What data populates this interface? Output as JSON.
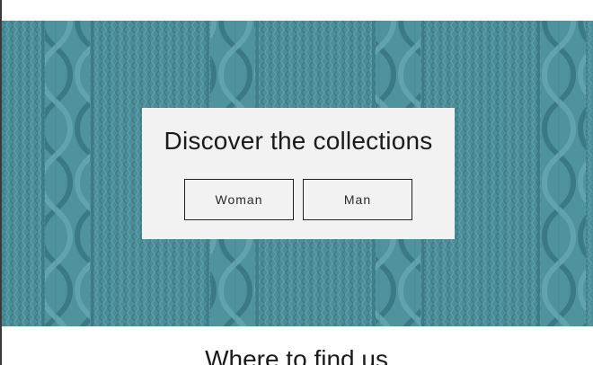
{
  "hero": {
    "background_color": "#4a8d96",
    "title": "Discover the collections",
    "buttons": {
      "woman_label": "Woman",
      "man_label": "Man"
    }
  },
  "next_section": {
    "heading": "Where to find us"
  }
}
